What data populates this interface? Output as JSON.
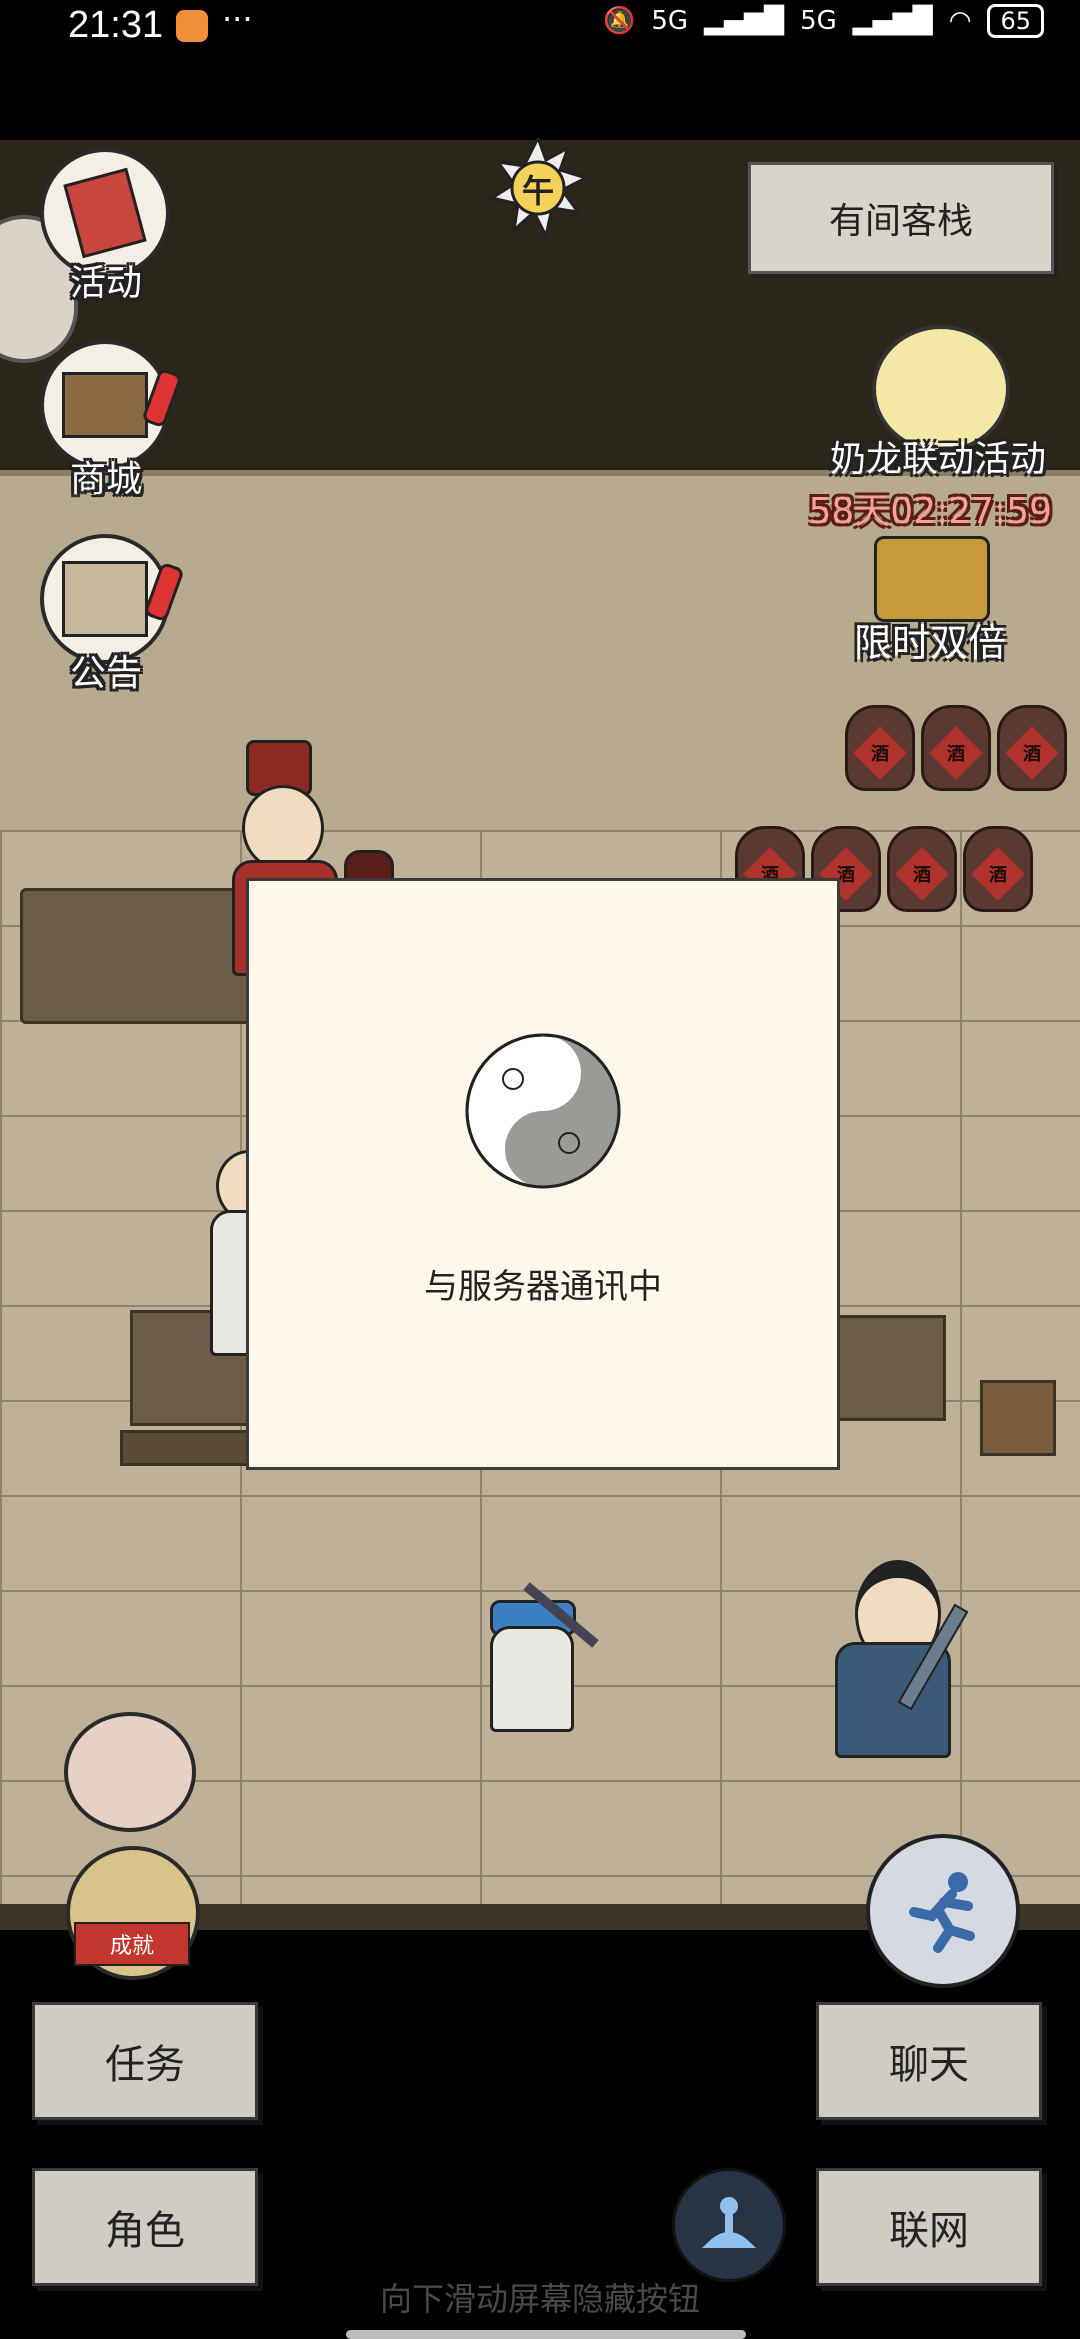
{
  "status_bar": {
    "time": "21:31",
    "signal_1": "5G",
    "signal_2": "5G",
    "battery": "65"
  },
  "scene": {
    "sign": "有间客栈",
    "time_of_day": "午",
    "jar_text": "酒"
  },
  "left_menu": [
    {
      "label": "活动",
      "icon": "banner-icon"
    },
    {
      "label": "商城",
      "icon": "shop-icon"
    },
    {
      "label": "公告",
      "icon": "notice-board-icon"
    }
  ],
  "event": {
    "title": "奶龙联动活动",
    "timer": "58天02:27:59",
    "double_label": "限时双倍"
  },
  "modal": {
    "message": "与服务器通讯中"
  },
  "achievement_badge": "成就",
  "buttons": {
    "task": "任务",
    "chat": "聊天",
    "role": "角色",
    "network": "联网"
  },
  "hint": "向下滑动屏幕隐藏按钮",
  "colors": {
    "modal_bg": "#fdf8ea",
    "button_bg": "#cfccc4",
    "timer_red": "#f4a29a"
  }
}
